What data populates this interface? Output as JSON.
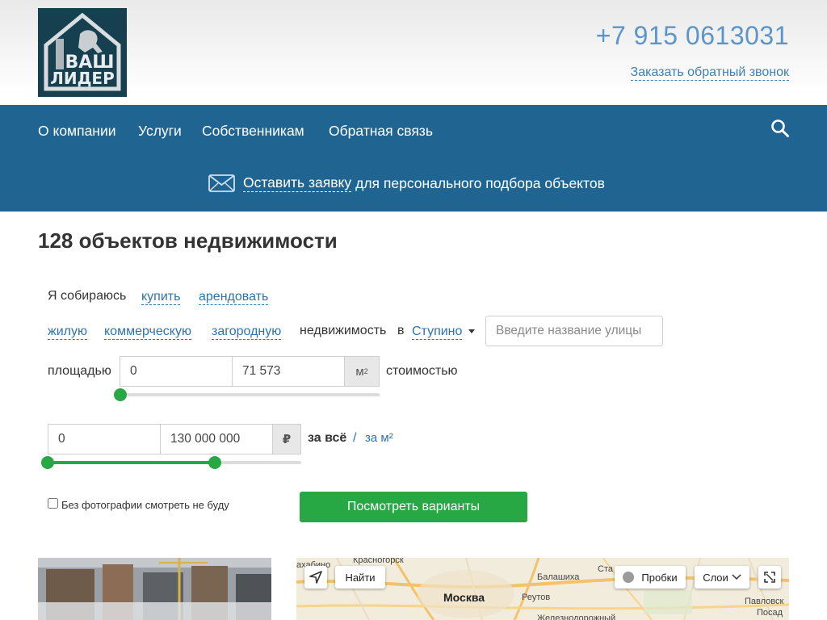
{
  "header": {
    "logo_text": [
      "ВАШ",
      "ЛИДЕР"
    ],
    "phone": "+7 915 0613031",
    "callback": "Заказать обратный звонок"
  },
  "nav": {
    "items": [
      "О компании",
      "Услуги",
      "Собственникам",
      "Обратная связь"
    ],
    "request_link": "Оставить заявку",
    "request_rest": "для персонального подбора объектов"
  },
  "page_title": "128 объектов недвижимости",
  "filter": {
    "intro": "Я собираюсь",
    "buy": "купить",
    "rent": "арендовать",
    "types": [
      "жилую",
      "коммерческую",
      "загородную"
    ],
    "property_in": "недвижимость",
    "in_word": "в",
    "city": "Ступино",
    "street_placeholder": "Введите название улицы",
    "area_label": "площадью",
    "area_min": "0",
    "area_max": "71 573",
    "area_unit": "м",
    "area_unit_sup": "2",
    "cost_label": "стоимостью",
    "price_min": "0",
    "price_max": "130 000 000",
    "price_unit": "₽",
    "for_all": "за всё",
    "slash": "/",
    "per_m2": "за м²",
    "no_photo_label": "Без фотографии смотреть не буду",
    "submit": "Посмотреть варианты",
    "area_slider": {
      "lower": 0.0,
      "upper": 0.0
    },
    "price_slider": {
      "lower": 0.0,
      "upper": 0.66
    }
  },
  "map": {
    "find_button": "Найти",
    "traffic_button": "Пробки",
    "layers_button": "Слои",
    "places": [
      "ахабино",
      "Красногорск",
      "Балашиха",
      "Ста",
      "Москва",
      "Реутов",
      "Павловск",
      "Посад",
      "Железнодорожный"
    ]
  },
  "colors": {
    "nav": "#206591",
    "accent": "#28a745",
    "link": "#2e73ad",
    "phone": "#5b95c9"
  },
  "icons": [
    "search-icon",
    "mail-icon",
    "locate-arrow-icon",
    "traffic-icon",
    "chevron-down-icon",
    "fullscreen-icon"
  ]
}
